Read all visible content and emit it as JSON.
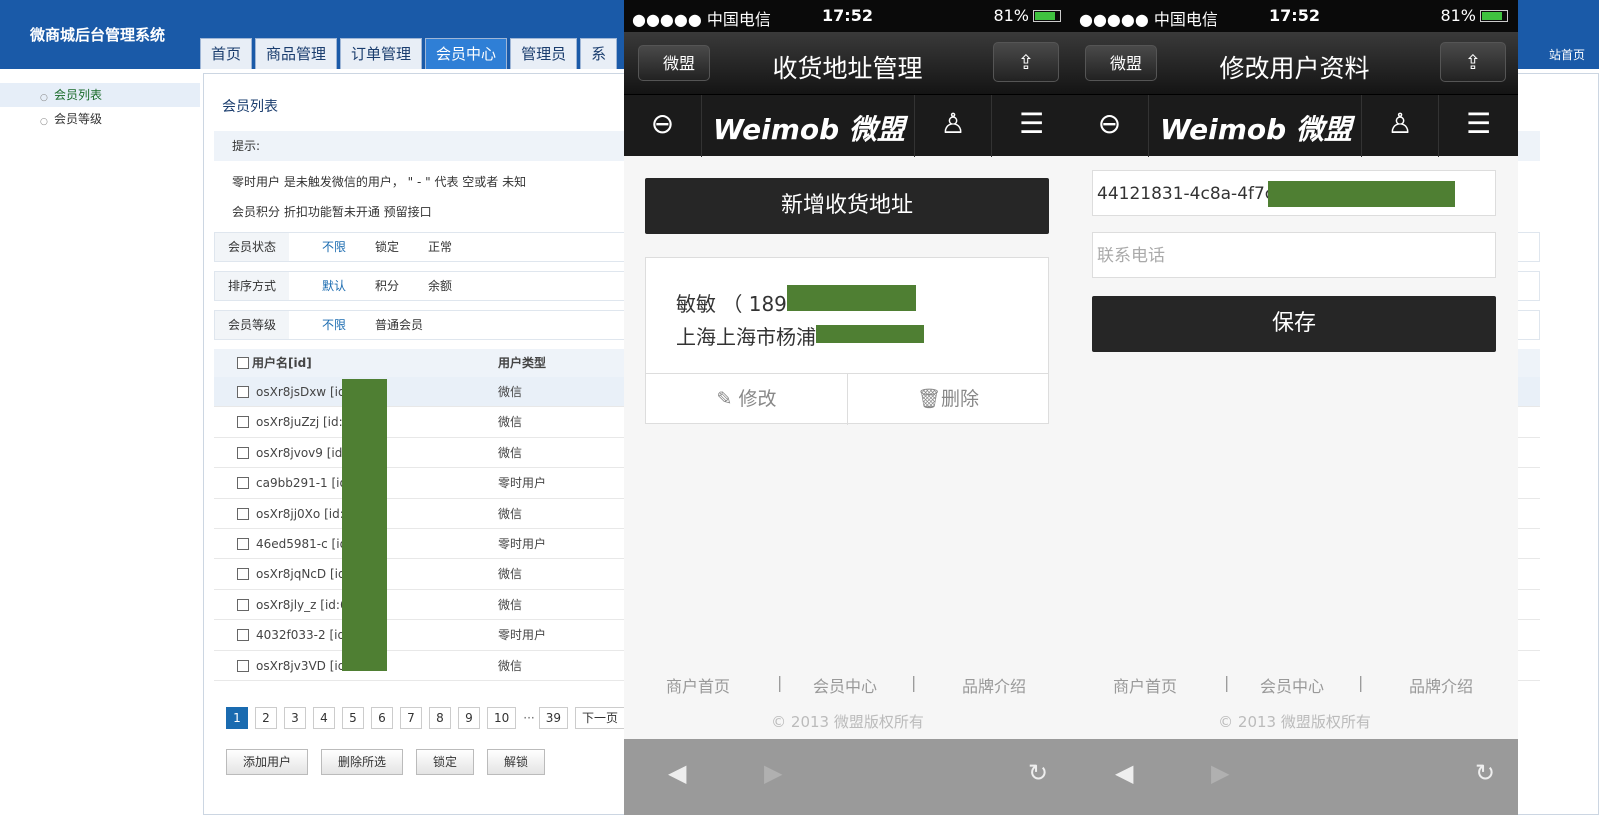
{
  "admin": {
    "title": "微商城后台管理系统",
    "nav": [
      "首页",
      "商品管理",
      "订单管理",
      "会员中心",
      "管理员",
      "系"
    ],
    "active_nav": 3,
    "right_link": "站首页",
    "sidebar": [
      "会员列表",
      "会员等级"
    ],
    "page_title": "会员列表",
    "hint_title": "提示:",
    "notes": [
      "零时用户 是未触发微信的用户， \" - \" 代表 空或者 未知",
      "会员积分 折扣功能暂未开通 预留接口"
    ],
    "filters": [
      {
        "label": "会员状态",
        "options": [
          "不限",
          "锁定",
          "正常"
        ]
      },
      {
        "label": "排序方式",
        "options": [
          "默认",
          "积分",
          "余额"
        ]
      },
      {
        "label": "会员等级",
        "options": [
          "不限",
          "普通会员"
        ]
      }
    ],
    "table_headers": [
      "用户名[id]",
      "用户类型"
    ],
    "rows": [
      {
        "name": "osXr8jsDxw [id:6",
        "type": "微信"
      },
      {
        "name": "osXr8juZzj [id:61",
        "type": "微信"
      },
      {
        "name": "osXr8jvov9 [id:61",
        "type": "微信"
      },
      {
        "name": "ca9bb291-1 [id:6",
        "type": "零时用户"
      },
      {
        "name": "osXr8jj0Xo [id:61",
        "type": "微信"
      },
      {
        "name": "46ed5981-c [id:6",
        "type": "零时用户"
      },
      {
        "name": "osXr8jqNcD [id:6",
        "type": "微信"
      },
      {
        "name": "osXr8jly_z [id:61",
        "type": "微信"
      },
      {
        "name": "4032f033-2 [id:6",
        "type": "零时用户"
      },
      {
        "name": "osXr8jv3VD [id:6",
        "type": "微信"
      }
    ],
    "pager": [
      "1",
      "2",
      "3",
      "4",
      "5",
      "6",
      "7",
      "8",
      "9",
      "10",
      "39",
      "下一页"
    ],
    "pager_ellipsis": "···",
    "actions": [
      "添加用户",
      "删除所选",
      "锁定",
      "解锁"
    ]
  },
  "phone1": {
    "carrier": "●●●●● 中国电信",
    "time": "17:52",
    "battery": "81%",
    "back_label": "微盟",
    "title": "收货地址管理",
    "logo": "Weimob 微盟",
    "add_button": "新增收货地址",
    "addr_name": "敏敏 （ 189",
    "addr_line": "上海上海市杨浦",
    "edit_label": "修改",
    "delete_label": "删除",
    "footer_links": [
      "商户首页",
      "|",
      "会员中心",
      "|",
      "品牌介绍"
    ],
    "copyright": "© 2013 微盟版权所有"
  },
  "phone2": {
    "carrier": "●●●●● 中国电信",
    "time": "17:52",
    "battery": "81%",
    "back_label": "微盟",
    "title": "修改用户资料",
    "logo": "Weimob 微盟",
    "field_value": "44121831-4c8a-4f7c-",
    "phone_placeholder": "联系电话",
    "save_button": "保存",
    "footer_links": [
      "商户首页",
      "|",
      "会员中心",
      "|",
      "品牌介绍"
    ],
    "copyright": "© 2013 微盟版权所有"
  }
}
